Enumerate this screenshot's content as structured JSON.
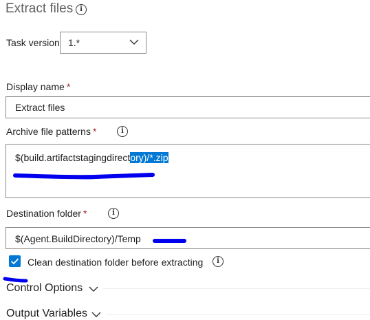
{
  "header": {
    "title": "Extract files"
  },
  "task_version": {
    "label": "Task version",
    "value": "1.*"
  },
  "display_name": {
    "label": "Display name",
    "required": "*",
    "value": "Extract files"
  },
  "archive_patterns": {
    "label": "Archive file patterns",
    "required": "*",
    "value_start": "$(build.artifactstagingdirect",
    "value_selected": "ory)/*.zip"
  },
  "destination": {
    "label": "Destination folder",
    "required": "*",
    "value": "$(Agent.BuildDirectory)/Temp"
  },
  "clean_checkbox": {
    "label": "Clean destination folder before extracting",
    "checked": true
  },
  "sections": {
    "control_options": "Control Options",
    "output_variables": "Output Variables"
  },
  "annotations": {
    "color": "#0000ee"
  },
  "colors": {
    "accent": "#0078d4",
    "required": "#a4262c"
  }
}
